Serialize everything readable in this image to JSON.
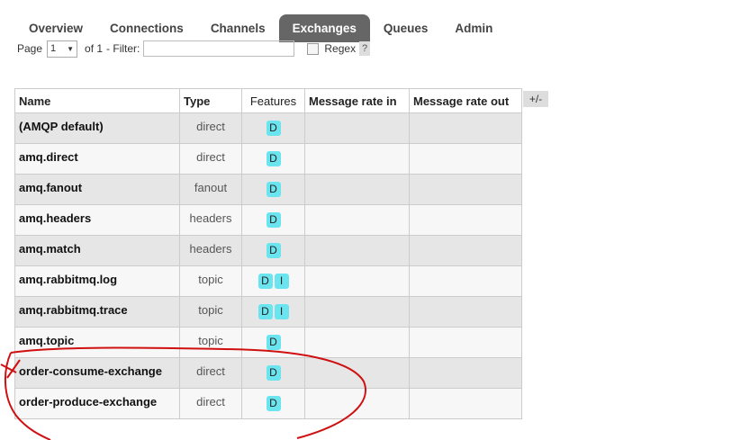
{
  "nav": {
    "tabs": [
      {
        "label": "Overview"
      },
      {
        "label": "Connections"
      },
      {
        "label": "Channels"
      },
      {
        "label": "Exchanges",
        "active": true
      },
      {
        "label": "Queues"
      },
      {
        "label": "Admin"
      }
    ]
  },
  "filter": {
    "page_label": "Page",
    "page_value": "1",
    "of_label": "of 1",
    "filter_label": "- Filter:",
    "filter_value": "",
    "regex_label": "Regex",
    "help_label": "?"
  },
  "table": {
    "headers": [
      "Name",
      "Type",
      "Features",
      "Message rate in",
      "Message rate out"
    ],
    "columns_toggle": "+/-",
    "rows": [
      {
        "name": "(AMQP default)",
        "type": "direct",
        "features": [
          "D"
        ],
        "rate_in": "",
        "rate_out": ""
      },
      {
        "name": "amq.direct",
        "type": "direct",
        "features": [
          "D"
        ],
        "rate_in": "",
        "rate_out": ""
      },
      {
        "name": "amq.fanout",
        "type": "fanout",
        "features": [
          "D"
        ],
        "rate_in": "",
        "rate_out": ""
      },
      {
        "name": "amq.headers",
        "type": "headers",
        "features": [
          "D"
        ],
        "rate_in": "",
        "rate_out": ""
      },
      {
        "name": "amq.match",
        "type": "headers",
        "features": [
          "D"
        ],
        "rate_in": "",
        "rate_out": ""
      },
      {
        "name": "amq.rabbitmq.log",
        "type": "topic",
        "features": [
          "D",
          "I"
        ],
        "rate_in": "",
        "rate_out": ""
      },
      {
        "name": "amq.rabbitmq.trace",
        "type": "topic",
        "features": [
          "D",
          "I"
        ],
        "rate_in": "",
        "rate_out": ""
      },
      {
        "name": "amq.topic",
        "type": "topic",
        "features": [
          "D"
        ],
        "rate_in": "",
        "rate_out": ""
      },
      {
        "name": "order-consume-exchange",
        "type": "direct",
        "features": [
          "D"
        ],
        "rate_in": "",
        "rate_out": ""
      },
      {
        "name": "order-produce-exchange",
        "type": "direct",
        "features": [
          "D"
        ],
        "rate_in": "",
        "rate_out": ""
      }
    ]
  },
  "colors": {
    "active_tab": "#666666",
    "feature_badge": "#6ae4ef",
    "annotation": "#d01010"
  }
}
